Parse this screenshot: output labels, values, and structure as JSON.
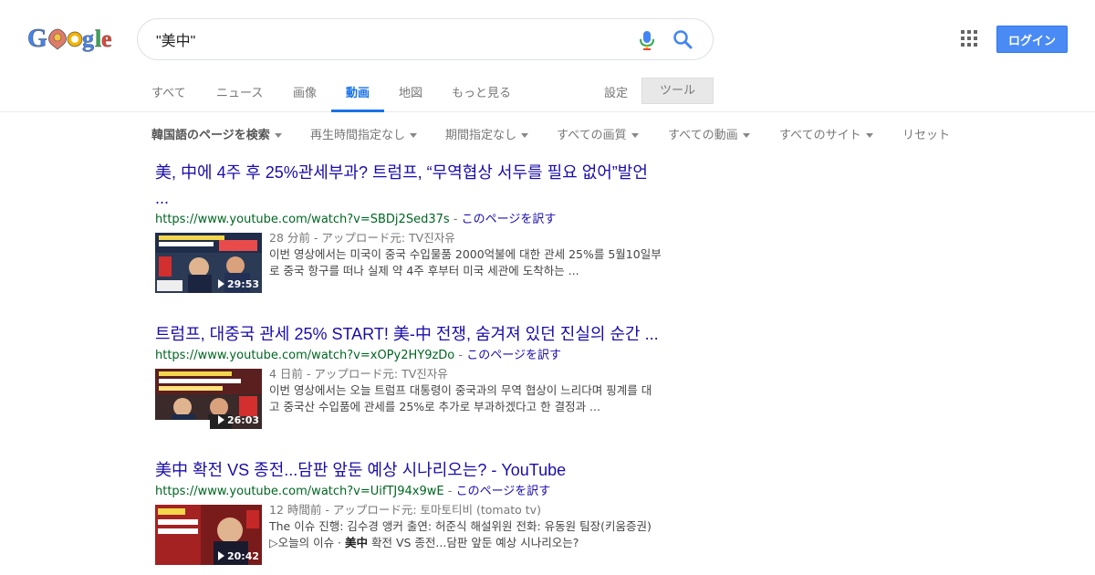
{
  "header": {
    "logo_alt": "Google",
    "search_value": "\"美中\"",
    "login_label": "ログイン"
  },
  "tabs": [
    {
      "label": "すべて",
      "active": false
    },
    {
      "label": "ニュース",
      "active": false
    },
    {
      "label": "画像",
      "active": false
    },
    {
      "label": "動画",
      "active": true
    },
    {
      "label": "地図",
      "active": false
    },
    {
      "label": "もっと見る",
      "active": false
    }
  ],
  "settings_label": "設定",
  "tools_label": "ツール",
  "filters": [
    "韓国語のページを検索",
    "再生時間指定なし",
    "期間指定なし",
    "すべての画質",
    "すべての動画",
    "すべてのサイト",
    "リセット"
  ],
  "results": [
    {
      "title_line1": "美, 中에 4주 후 25%관세부과? 트럼프, “무역협상 서두를 필요 없어”발언",
      "title_line2": "...",
      "url": "https://www.youtube.com/watch?v=SBDj2Sed37s",
      "separator": " - ",
      "translate": "このページを訳す",
      "meta": "28 分前 - アップロード元: TV진자유",
      "snippet_line1": "이번 영상에서는 미국이 중국 수입물품 2000억불에 대한 관세 25%를 5월10일부",
      "snippet_line2": "로 중국 항구를 떠나 실제 약 4주 후부터 미국 세관에 도착하는 ...",
      "duration": "29:53"
    },
    {
      "title_line1": "트럼프, 대중국 관세 25% START! 美-中 전쟁, 숨겨져 있던 진실의 순간 ...",
      "url": "https://www.youtube.com/watch?v=xOPy2HY9zDo",
      "separator": " - ",
      "translate": "このページを訳す",
      "meta": "4 日前 - アップロード元: TV진자유",
      "snippet_line1": "이번 영상에서는 오늘 트럼프 대통령이 중국과의 무역 협상이 느리다며 핑계를 대",
      "snippet_line2": "고 중국산 수입품에 관세를 25%로 추가로 부과하겠다고 한 결정과 ...",
      "duration": "26:03"
    },
    {
      "title_line1": "美中 확전 VS 종전...담판 앞둔 예상 시나리오는? - YouTube",
      "url": "https://www.youtube.com/watch?v=UifTJ94x9wE",
      "separator": " - ",
      "translate": "このページを訳す",
      "meta": "12 時間前 - アップロード元: 토마토티비 (tomato tv)",
      "snippet_line1": "The 이슈 진행: 김수경 앵커 출연: 허준식 해설위원 전화: 유동원 팀장(키움증권)",
      "snippet_line2_pre": "▷오늘의 이슈 · ",
      "snippet_line2_bold": "美中",
      "snippet_line2_post": " 확전 VS 종전...담판 앞둔 예상 시나리오는?",
      "duration": "20:42"
    }
  ],
  "colors": {
    "link": "#1a0dab",
    "url_green": "#006621",
    "active_tab": "#1a73e8",
    "login_bg": "#4a8af4"
  }
}
